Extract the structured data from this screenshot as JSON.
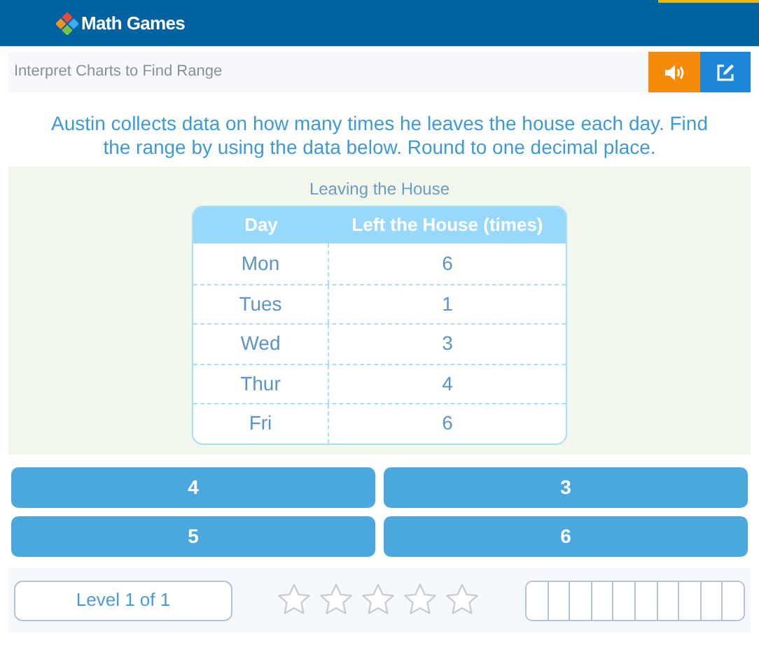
{
  "header": {
    "logo_text": "Math Games"
  },
  "title_bar": {
    "title": "Interpret Charts to Find Range"
  },
  "question": "Austin collects data on how many times he leaves the house each day. Find the range by using the data below. Round to one decimal place.",
  "table": {
    "caption": "Leaving the House",
    "columns": [
      "Day",
      "Left the House (times)"
    ],
    "rows": [
      [
        "Mon",
        "6"
      ],
      [
        "Tues",
        "1"
      ],
      [
        "Wed",
        "3"
      ],
      [
        "Thur",
        "4"
      ],
      [
        "Fri",
        "6"
      ]
    ]
  },
  "answers": [
    "4",
    "3",
    "5",
    "6"
  ],
  "footer": {
    "level_label": "Level 1 of 1",
    "stars": 0
  }
}
